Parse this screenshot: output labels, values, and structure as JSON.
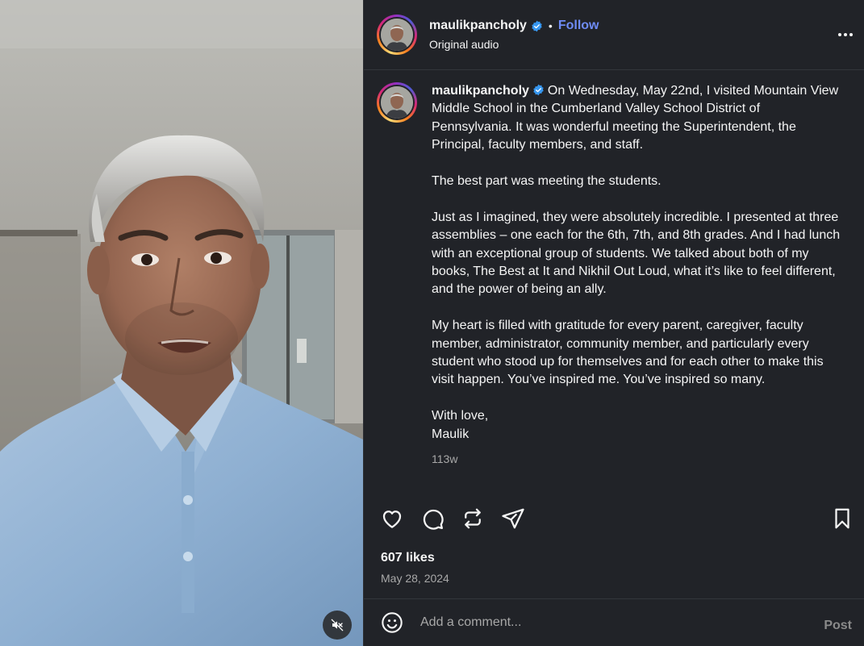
{
  "header": {
    "username": "maulikpancholy",
    "separator": "•",
    "follow_label": "Follow",
    "audio_label": "Original audio",
    "more_icon": "more-horizontal-icon"
  },
  "caption": {
    "username": "maulikpancholy",
    "paragraphs": [
      "On Wednesday, May 22nd, I visited Mountain View Middle School in the Cumberland Valley School District of Pennsylvania. It was wonderful meeting the Superintendent, the Principal, faculty members, and staff.",
      "The best part was meeting the students.",
      "Just as I imagined, they were absolutely incredible. I presented at three assemblies – one each for the 6th, 7th, and 8th grades. And I had lunch with an exceptional group of students. We talked about both of my books, The Best at It and Nikhil Out Loud, what it’s like to feel different, and the power of being an ally.",
      "My heart is filled with gratitude for every parent, caregiver, faculty member, administrator, community member, and particularly every student who stood up for themselves and for each other to make this visit happen. You’ve inspired me. You’ve inspired so many.",
      "With love,",
      "Maulik"
    ],
    "time_ago": "113w"
  },
  "actions": {
    "icons": [
      "heart-icon",
      "comment-icon",
      "repost-icon",
      "share-icon",
      "bookmark-icon"
    ]
  },
  "stats": {
    "likes": "607 likes",
    "date": "May 28, 2024"
  },
  "comment": {
    "placeholder": "Add a comment...",
    "post_label": "Post"
  },
  "video": {
    "mute_icon": "muted-speaker-icon"
  },
  "colors": {
    "panel_bg": "#212328",
    "accent_link": "#6f8cf6",
    "verified": "#3797f0",
    "muted_text": "#a8a8a8"
  }
}
